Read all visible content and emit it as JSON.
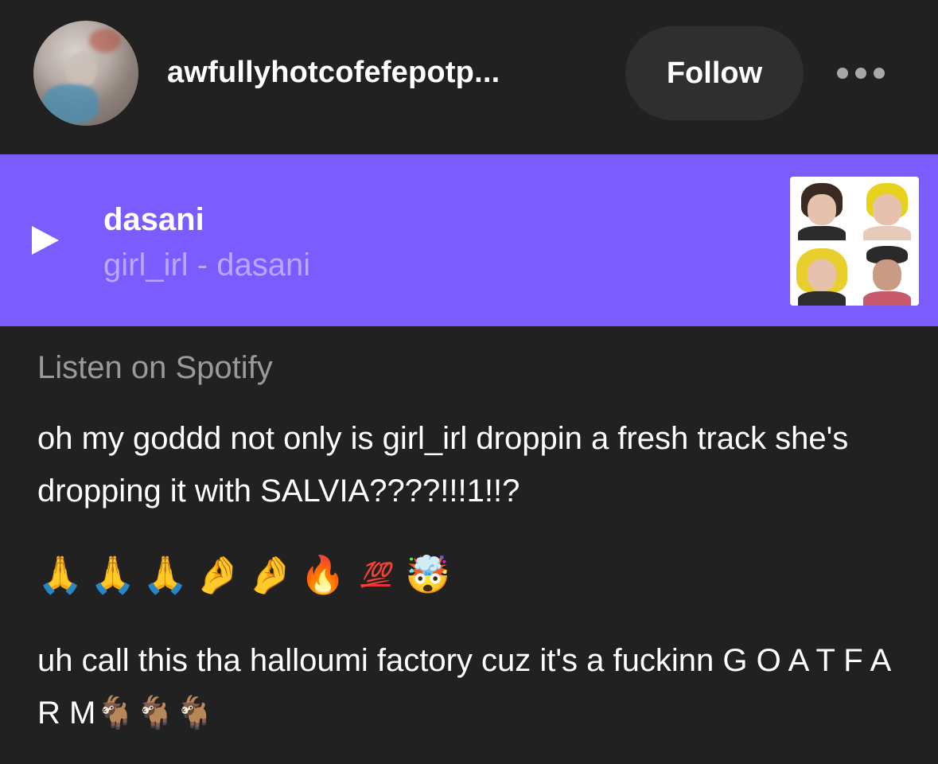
{
  "header": {
    "username": "awfullyhotcofefepotp...",
    "follow_label": "Follow",
    "avatar_icon": "avatar-photo",
    "more_icon": "more-horizontal-icon"
  },
  "audio": {
    "title": "dasani",
    "subtitle": "girl_irl - dasani",
    "play_icon": "play-icon",
    "background": "#7a5cff"
  },
  "post": {
    "listen_link": "Listen on Spotify",
    "paragraph1": "oh my goddd not only is girl_irl droppin a fresh track she's dropping it with SALVIA????!!!1!!?",
    "emojis": [
      "🙏",
      "🙏",
      "🙏",
      "🤌",
      "🤌",
      "🔥",
      "💯",
      "🤯"
    ],
    "paragraph2": "uh call this tha halloumi factory cuz it's a fuckinn G O A T F A R M🐐🐐🐐"
  },
  "colors": {
    "background": "#212121",
    "accent": "#7a5cff",
    "muted_text": "#9a9a9a"
  }
}
